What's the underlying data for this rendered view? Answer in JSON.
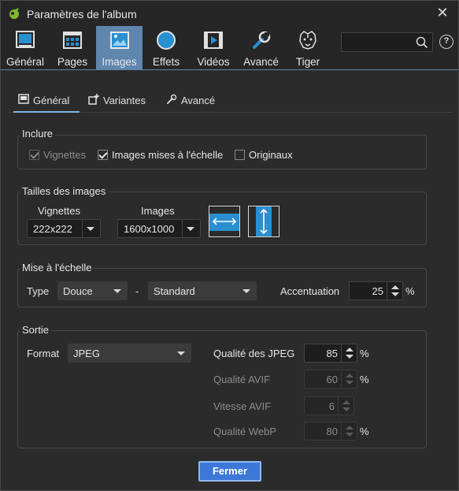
{
  "window": {
    "title": "Paramètres de l'album"
  },
  "toolbar": {
    "tabs": [
      {
        "label": "Général",
        "icon": "general-icon"
      },
      {
        "label": "Pages",
        "icon": "pages-icon"
      },
      {
        "label": "Images",
        "icon": "images-icon",
        "active": true
      },
      {
        "label": "Effets",
        "icon": "effects-icon"
      },
      {
        "label": "Vidéos",
        "icon": "videos-icon"
      },
      {
        "label": "Avancé",
        "icon": "wrench-icon"
      },
      {
        "label": "Tiger",
        "icon": "tiger-icon"
      }
    ],
    "search": {
      "value": "",
      "placeholder": ""
    },
    "help_label": "?"
  },
  "subtabs": [
    {
      "label": "Général",
      "icon": "window-icon",
      "active": true
    },
    {
      "label": "Variantes",
      "icon": "add-variant-icon"
    },
    {
      "label": "Avancé",
      "icon": "wrench-icon"
    }
  ],
  "include": {
    "title": "Inclure",
    "thumbnails": {
      "label": "Vignettes",
      "checked": true,
      "disabled": true
    },
    "scaled": {
      "label": "Images mises à l'échelle",
      "checked": true
    },
    "originals": {
      "label": "Originaux",
      "checked": false
    }
  },
  "sizes": {
    "title": "Tailles des images",
    "thumb_label": "Vignettes",
    "thumb_value": "222x222",
    "image_label": "Images",
    "image_value": "1600x1000"
  },
  "scaling": {
    "title": "Mise à l'échelle",
    "type_label": "Type",
    "type_value": "Douce",
    "dash": "-",
    "mode_value": "Standard",
    "sharpen_label": "Accentuation",
    "sharpen_value": "25",
    "sharpen_unit": "%"
  },
  "output": {
    "title": "Sortie",
    "format_label": "Format",
    "format_value": "JPEG",
    "jpeg_quality_label": "Qualité des JPEG",
    "jpeg_quality_value": "85",
    "avif_quality_label": "Qualité AVIF",
    "avif_quality_value": "60",
    "avif_speed_label": "Vitesse AVIF",
    "avif_speed_value": "6",
    "webp_quality_label": "Qualité WebP",
    "webp_quality_value": "80",
    "percent": "%"
  },
  "footer": {
    "close_label": "Fermer"
  },
  "colors": {
    "accent": "#5f86ad",
    "button": "#3d78d8",
    "background": "#2b2b2b",
    "tiles_blue": "#2a8fd0"
  }
}
